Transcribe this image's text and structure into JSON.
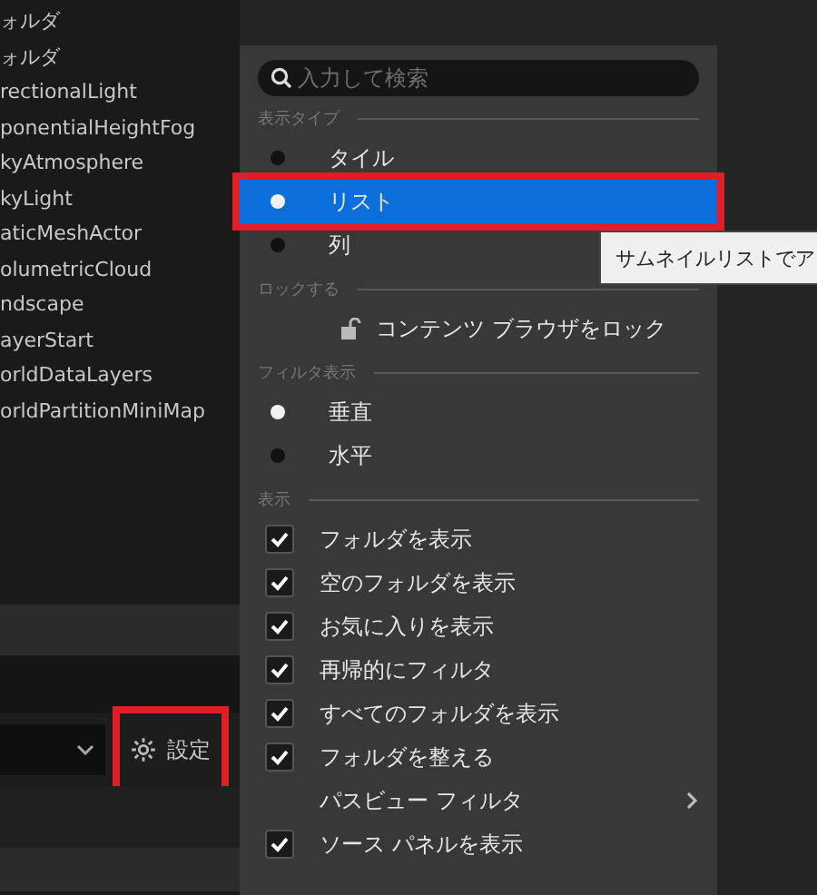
{
  "outliner": {
    "items": [
      "ォルダ",
      "ォルダ",
      "rectionalLight",
      "ponentialHeightFog",
      "kyAtmosphere",
      "kyLight",
      "aticMeshActor",
      "olumetricCloud",
      "ndscape",
      "ayerStart",
      "orldDataLayers",
      "orldPartitionMiniMap"
    ]
  },
  "settings_button": {
    "label": "設定",
    "highlighted": true
  },
  "menu": {
    "search": {
      "placeholder": "入力して検索"
    },
    "sections": [
      {
        "title": "表示タイプ",
        "items": [
          {
            "kind": "radio",
            "label": "タイル",
            "selected": false,
            "highlighted": false
          },
          {
            "kind": "radio",
            "label": "リスト",
            "selected": true,
            "highlighted": true
          },
          {
            "kind": "radio",
            "label": "列",
            "selected": false,
            "highlighted": false
          }
        ]
      },
      {
        "title": "ロックする",
        "items": [
          {
            "kind": "lock",
            "label": "コンテンツ ブラウザをロック"
          }
        ]
      },
      {
        "title": "フィルタ表示",
        "items": [
          {
            "kind": "radio",
            "label": "垂直",
            "selected": true,
            "highlighted": false
          },
          {
            "kind": "radio",
            "label": "水平",
            "selected": false,
            "highlighted": false
          }
        ]
      },
      {
        "title": "表示",
        "items": [
          {
            "kind": "checkbox",
            "label": "フォルダを表示",
            "checked": true
          },
          {
            "kind": "checkbox",
            "label": "空のフォルダを表示",
            "checked": true
          },
          {
            "kind": "checkbox",
            "label": "お気に入りを表示",
            "checked": true
          },
          {
            "kind": "checkbox",
            "label": "再帰的にフィルタ",
            "checked": true
          },
          {
            "kind": "checkbox",
            "label": "すべてのフォルダを表示",
            "checked": true
          },
          {
            "kind": "checkbox",
            "label": "フォルダを整える",
            "checked": true
          },
          {
            "kind": "submenu",
            "label": "パスビュー フィルタ"
          },
          {
            "kind": "checkbox",
            "label": "ソース パネルを表示",
            "checked": true
          }
        ]
      }
    ]
  },
  "tooltip": {
    "text": "サムネイルリストでア"
  }
}
